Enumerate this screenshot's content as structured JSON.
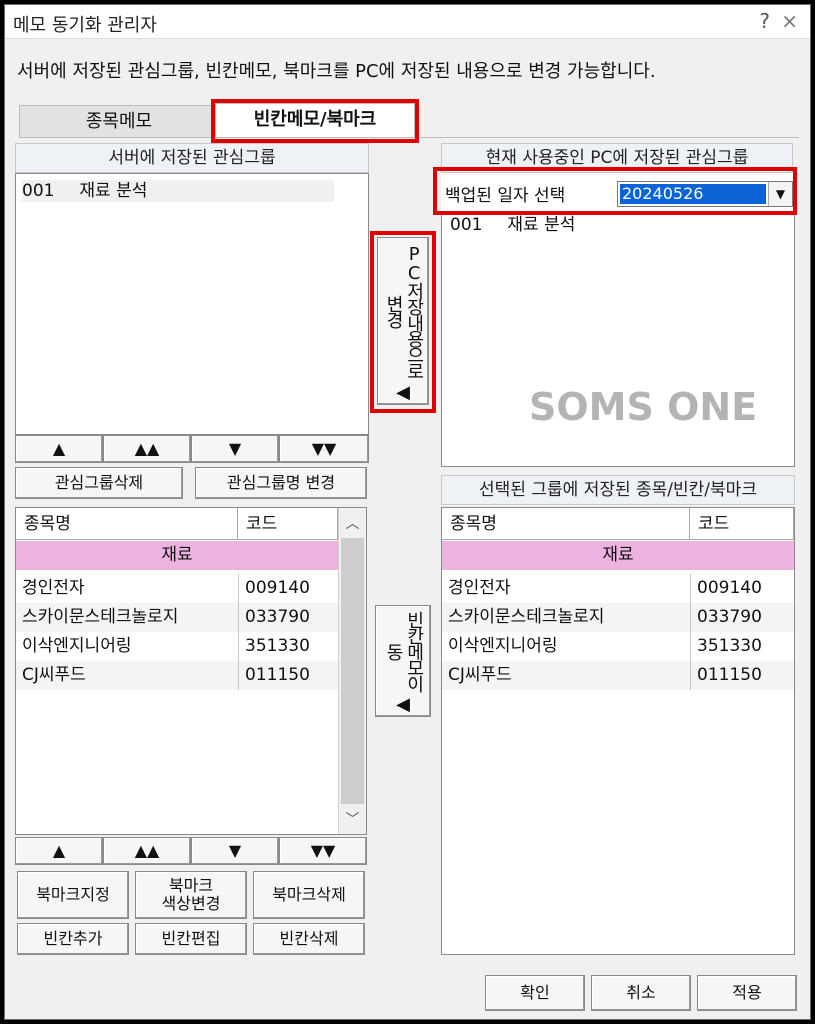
{
  "window": {
    "title": "메모 동기화 관리자",
    "help": "?",
    "close": "×"
  },
  "description": "서버에 저장된 관심그룹, 빈칸메모, 북마크를 PC에 저장된 내용으로 변경 가능합니다.",
  "tabs": [
    {
      "label": "종목메모",
      "active": false
    },
    {
      "label": "빈칸메모/북마크",
      "active": true
    }
  ],
  "left": {
    "server_header": "서버에 저장된 관심그룹",
    "groups": [
      {
        "code": "001",
        "name": "재료 분석"
      }
    ],
    "move_buttons": [
      "▲",
      "▲▲",
      "▼",
      "▼▼"
    ],
    "delete_group": "관심그룹삭제",
    "rename_group": "관심그룹명 변경",
    "grid": {
      "columns": [
        "종목명",
        "코드"
      ],
      "group_row": "재료",
      "rows": [
        {
          "name": "경인전자",
          "code": "009140"
        },
        {
          "name": "스카이문스테크놀로지",
          "code": "033790"
        },
        {
          "name": "이삭엔지니어링",
          "code": "351330"
        },
        {
          "name": "CJ씨푸드",
          "code": "011150"
        }
      ]
    },
    "move_buttons2": [
      "▲",
      "▲▲",
      "▼",
      "▼▼"
    ],
    "bookmark_set": "북마크지정",
    "bookmark_color": "북마크\n색상변경",
    "bookmark_delete": "북마크삭제",
    "blank_add": "빈칸추가",
    "blank_edit": "빈칸편집",
    "blank_delete": "빈칸삭제"
  },
  "middle": {
    "pc_change": "PC저장내용으로변경",
    "pc_change_arrow": "◀",
    "blank_move": "빈칸메모이동",
    "blank_move_arrow": "◀"
  },
  "right": {
    "pc_header": "현재 사용중인 PC에 저장된 관심그룹",
    "backup_label": "백업된 일자 선택",
    "backup_date": "20240526",
    "groups": [
      {
        "code": "001",
        "name": "재료 분석"
      }
    ],
    "watermark": "SOMS ONE",
    "selected_header": "선택된 그룹에 저장된 종목/빈칸/북마크",
    "grid": {
      "columns": [
        "종목명",
        "코드"
      ],
      "group_row": "재료",
      "rows": [
        {
          "name": "경인전자",
          "code": "009140"
        },
        {
          "name": "스카이문스테크놀로지",
          "code": "033790"
        },
        {
          "name": "이삭엔지니어링",
          "code": "351330"
        },
        {
          "name": "CJ씨푸드",
          "code": "011150"
        }
      ]
    }
  },
  "footer": {
    "ok": "확인",
    "cancel": "취소",
    "apply": "적용"
  },
  "colors": {
    "highlight_red": "#e00000",
    "group_row_pink": "#edb3e0",
    "selection_blue": "#0a64d8"
  }
}
